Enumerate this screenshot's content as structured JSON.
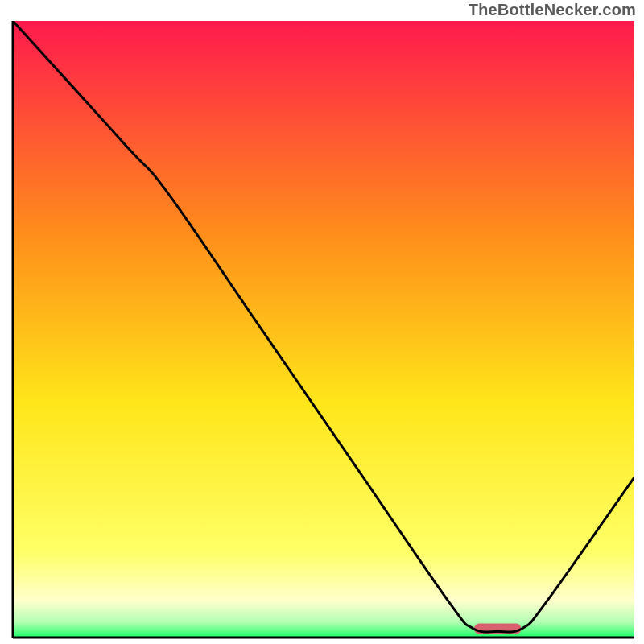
{
  "attribution": "TheBottleNecker.com",
  "chart_data": {
    "type": "line",
    "title": "",
    "xlabel": "",
    "ylabel": "",
    "xlim": [
      0,
      100
    ],
    "ylim": [
      0,
      100
    ],
    "grid": false,
    "legend": false,
    "background_gradient_top": "#ff1a4d",
    "background_gradient_mid_upper": "#ff9f1a",
    "background_gradient_mid_lower": "#ffe61a",
    "background_gradient_near_bottom": "#ffff99",
    "background_gradient_bottom": "#1aff66",
    "marker": {
      "x": 78,
      "y": 1.5,
      "color": "#d9606e",
      "shape": "rounded-bar"
    },
    "series": [
      {
        "name": "curve",
        "color": "#000000",
        "x": [
          0,
          18,
          25,
          40,
          55,
          70,
          74,
          78,
          82,
          86,
          100
        ],
        "y": [
          100,
          80,
          72,
          50,
          28,
          6,
          1.5,
          1.0,
          1.5,
          6,
          26
        ]
      }
    ]
  }
}
